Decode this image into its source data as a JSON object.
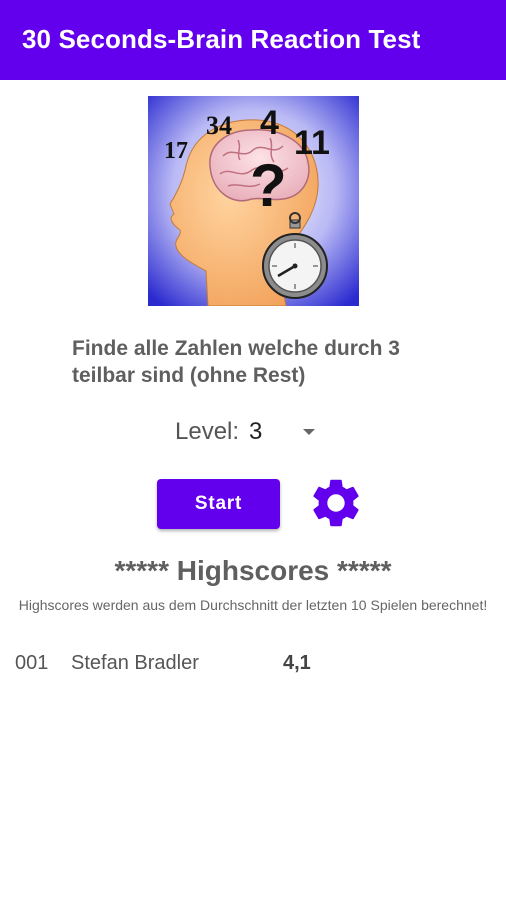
{
  "app": {
    "title": "30 Seconds-Brain Reaction Test"
  },
  "logo": {
    "numbers": [
      "17",
      "34",
      "4",
      "11"
    ],
    "question_mark": "?"
  },
  "instruction": "Finde alle Zahlen welche durch 3 teilbar sind (ohne Rest)",
  "level": {
    "label": "Level:",
    "value": "3"
  },
  "start_label": "Start",
  "icons": {
    "settings": "gear-icon",
    "dropdown": "chevron-down-icon"
  },
  "highscores": {
    "title": "***** Highscores *****",
    "subtitle": "Highscores werden aus dem Durchschnitt der letzten 10 Spielen berechnet!",
    "rows": [
      {
        "rank": "001",
        "name": "Stefan Bradler",
        "score": "4,1"
      }
    ]
  },
  "colors": {
    "accent": "#6200ee",
    "text": "#5f5f5f"
  }
}
